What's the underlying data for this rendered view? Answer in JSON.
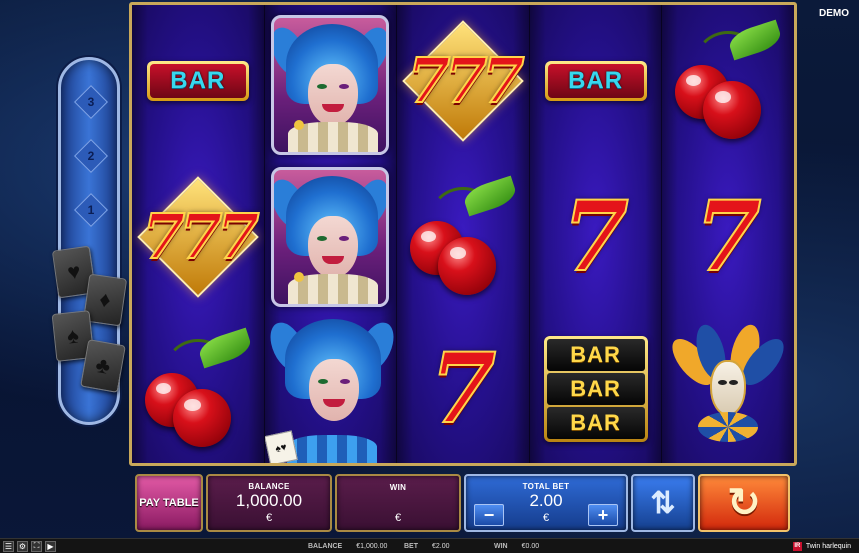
{
  "header": {
    "mode_badge": "DEMO"
  },
  "gamble_ladder": {
    "steps": [
      "3",
      "2",
      "1"
    ]
  },
  "reels": [
    [
      "BAR",
      "777",
      "cherries"
    ],
    [
      "joker",
      "joker",
      "joker"
    ],
    [
      "777",
      "cherries",
      "7"
    ],
    [
      "BAR",
      "7",
      "BAR BAR BAR"
    ],
    [
      "cherries",
      "7",
      "jester-mask"
    ]
  ],
  "symbols": {
    "bar_text": "BAR",
    "seven_text": "7",
    "triple_seven_text": "777",
    "triple_bar_lines": [
      "BAR",
      "BAR",
      "BAR"
    ]
  },
  "controls": {
    "paytable_label": "PAY TABLE",
    "balance_label": "BALANCE",
    "balance_value": "1,000.00",
    "balance_currency": "€",
    "win_label": "WIN",
    "win_value": "",
    "win_currency": "€",
    "total_bet_label": "TOTAL BET",
    "total_bet_value": "2.00",
    "total_bet_currency": "€",
    "bet_minus": "−",
    "bet_plus": "+",
    "autoplay_icon": "autoplay-icon",
    "spin_icon": "spin-icon"
  },
  "statusbar": {
    "balance_label": "BALANCE",
    "balance_value": "€1,000.00",
    "bet_label": "BET",
    "bet_value": "€2.00",
    "win_label": "WIN",
    "win_value": "€0.00",
    "game_title": "Twin harlequin",
    "logo_text": "IR"
  },
  "colors": {
    "frame_gold": "#c9a85a",
    "reel_purple": "#2b0f7a",
    "paytable_pink": "#e35aa6",
    "bet_blue": "#2f6bd6",
    "spin_orange": "#ff8a3a"
  }
}
